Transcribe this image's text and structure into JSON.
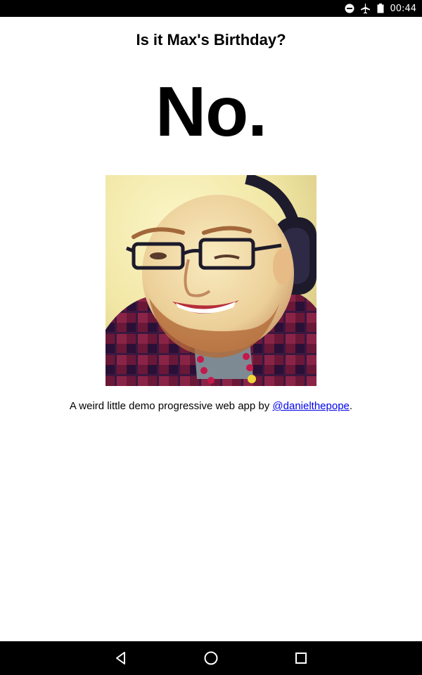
{
  "status_bar": {
    "time": "00:44",
    "icons": [
      "do-not-disturb-icon",
      "airplane-mode-icon",
      "battery-icon"
    ]
  },
  "page": {
    "title": "Is it Max's Birthday?",
    "answer": "No.",
    "photo_alt": "Max",
    "footer": {
      "prefix": "A weird little demo progressive web app by ",
      "link_text": "@danielthepope",
      "suffix": "."
    }
  },
  "nav_bar": {
    "icons": [
      "back-icon",
      "home-icon",
      "recents-icon"
    ]
  },
  "colors": {
    "bar_background": "#000000",
    "page_background": "#ffffff",
    "link": "#0000ee"
  }
}
